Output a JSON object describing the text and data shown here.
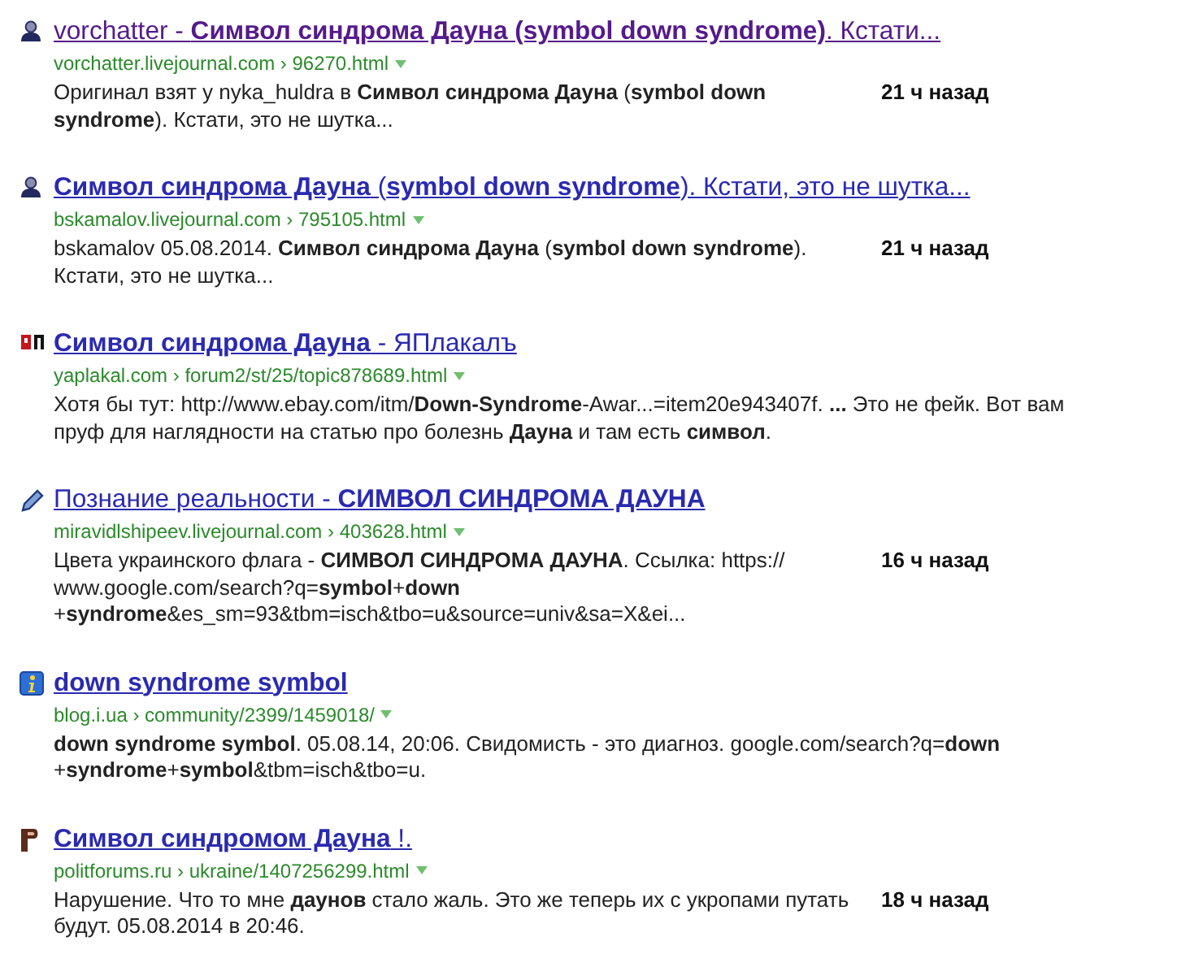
{
  "results": [
    {
      "kind": "person",
      "visited": true,
      "title": "vorchatter - **Символ синдрома Дауна (symbol down syndrome)**. Кстати...",
      "url": "vorchatter.livejournal.com › 96270.html",
      "snippet": "Оригинал взят у nyka_huldra в **Символ синдрома Дауна** (**symbol down syndrome**). Кстати, это не шутка...",
      "time": "21 ч назад"
    },
    {
      "kind": "person",
      "visited": false,
      "title": "**Символ синдрома Дауна** (**symbol down syndrome**). Кстати, это не шутка...",
      "url": "bskamalov.livejournal.com › 795105.html",
      "snippet": "bskamalov 05.08.2014. **Символ синдрома Дауна** (**symbol down syndrome**). Кстати, это не шутка...",
      "time": "21 ч назад"
    },
    {
      "kind": "yap",
      "visited": false,
      "title": "**Символ синдрома Дауна** - ЯПлакалъ",
      "url": "yaplakal.com › forum2/st/25/topic878689.html",
      "snippet": "Хотя бы тут: http://www.ebay.com/itm/**Down-Syndrome**-Awar...=item20e943407f. **...** Это не фейк. Вот вам пруф для наглядности на статью про болезнь **Дауна** и там есть **символ**."
    },
    {
      "kind": "pencil",
      "visited": false,
      "title": "Познание реальности - **СИМВОЛ СИНДРОМА ДАУНА**",
      "url": "miravidlshipeev.livejournal.com › 403628.html",
      "snippet": "Цвета украинского флага - **СИМВОЛ СИНДРОМА ДАУНА**. Ссылка: https:// www.google.com/search?q=**symbol**+**down** +**syndrome**&es_sm=93&tbm=isch&tbo=u&source=univ&sa=X&ei...",
      "time": "16 ч назад"
    },
    {
      "kind": "info",
      "visited": false,
      "title": "**down syndrome symbol**",
      "url": "blog.i.ua › community/2399/1459018/",
      "snippet": "**down syndrome symbol**. 05.08.14, 20:06. Свидомисть - это диагноз. google.com/search?q=**down** +**syndrome**+**symbol**&tbm=isch&tbo=u."
    },
    {
      "kind": "pf",
      "visited": false,
      "title": "**Символ синдромом Дауна** !.",
      "url": "politforums.ru › ukraine/1407256299.html",
      "snippet": "Нарушение. Что то мне **даунов** стало жаль. Это же теперь их с укропами путать будут. 05.08.2014 в 20:46.",
      "time": "18 ч назад"
    }
  ]
}
